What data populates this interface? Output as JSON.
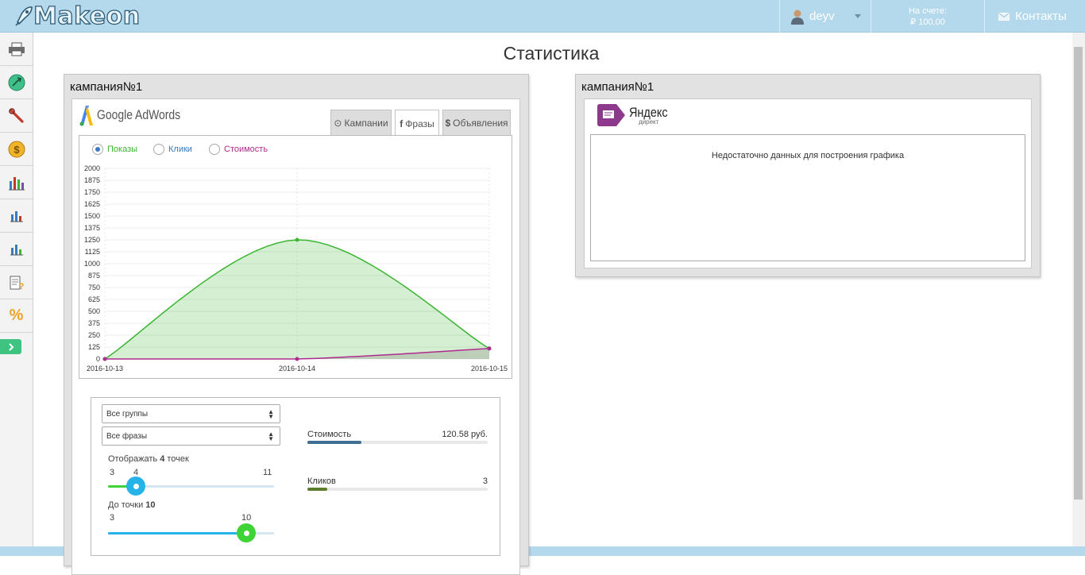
{
  "header": {
    "logo": "Makeon",
    "user_name": "deyv",
    "balance_label": "На счете:",
    "balance_value": "₽ 100,00",
    "contacts_label": "Контакты"
  },
  "sidebar": {
    "items": [
      "printer-icon",
      "globe-icon",
      "wrench-icon",
      "coin-icon",
      "bar-chart-icon",
      "bar-chart-small-icon",
      "bar-chart-small-2-icon",
      "document-question-icon",
      "percent-icon"
    ]
  },
  "page": {
    "title": "Статистика"
  },
  "left_panel": {
    "title": "кампания№1",
    "brand": "Google AdWords",
    "tabs": [
      {
        "icon": "⊙",
        "label": "Кампании",
        "active": false
      },
      {
        "icon": "f",
        "label": "Фразы",
        "active": true
      },
      {
        "icon": "$",
        "label": "Объявления",
        "active": false
      }
    ],
    "radios": [
      {
        "label": "Показы",
        "checked": true,
        "color": "#3bb531"
      },
      {
        "label": "Клики",
        "checked": false,
        "color": "#3a7bbf"
      },
      {
        "label": "Стоимость",
        "checked": false,
        "color": "#b02b8f"
      }
    ],
    "controls": {
      "group_select": "Все группы",
      "phrase_select": "Все фразы",
      "points_label_prefix": "Отображать",
      "points_value": "4",
      "points_label_suffix": "точек",
      "points_min": "3",
      "points_current": "4",
      "points_max": "11",
      "until_label_prefix": "До точки",
      "until_value": "10",
      "until_min": "3",
      "until_current": "10"
    },
    "stats": {
      "cost_label": "Стоимость",
      "cost_value": "120.58 руб.",
      "cost_fraction": 0.3,
      "clicks_label": "Кликов",
      "clicks_value": "3",
      "clicks_fraction": 0.11
    }
  },
  "right_panel": {
    "title": "кампания№1",
    "brand_name": "Яндекс",
    "brand_sub": "директ",
    "empty_message": "Недостаточно данных для построения графика"
  },
  "chart_data": {
    "type": "area",
    "x": [
      "2016-10-13",
      "2016-10-14",
      "2016-10-15"
    ],
    "series": [
      {
        "values": [
          0,
          1250,
          110
        ],
        "color": "#3bb531"
      },
      {
        "values": [
          0,
          0,
          110
        ],
        "color": "#b02b8f"
      }
    ],
    "yticks": [
      "2000",
      "1875",
      "1750",
      "1625",
      "1500",
      "1375",
      "1250",
      "1125",
      "1000",
      "875",
      "750",
      "625",
      "500",
      "375",
      "250",
      "125",
      "0"
    ],
    "ylim": [
      0,
      2000
    ],
    "grid": true
  },
  "colors": {
    "accent": "#b5d9ec",
    "sidebar_toggle": "#3fc380",
    "slider_blue": "#26b4e8",
    "slider_green": "#3ed336"
  }
}
